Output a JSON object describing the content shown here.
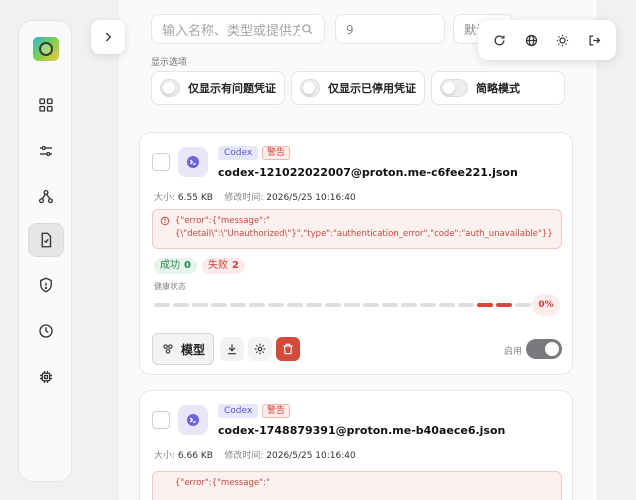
{
  "sidebar": {
    "items": [
      {
        "icon": "grid-icon"
      },
      {
        "icon": "sliders-icon"
      },
      {
        "icon": "share-nodes-icon"
      },
      {
        "icon": "document-check-icon",
        "active": true
      },
      {
        "icon": "shield-icon"
      },
      {
        "icon": "clock-icon"
      },
      {
        "icon": "chip-icon"
      }
    ]
  },
  "filters": {
    "search_placeholder": "输入名称、类型或提供方",
    "page_size": "9",
    "sort_label": "默认"
  },
  "display_options": {
    "label": "显示选项",
    "toggles": [
      {
        "label": "仅显示有问题凭证",
        "on": false
      },
      {
        "label": "仅显示已停用凭证",
        "on": false
      },
      {
        "label": "简略模式",
        "on": false
      }
    ]
  },
  "cards": [
    {
      "provider": "Codex",
      "status": "警告",
      "name": "codex-121022022007@proton.me-c6fee221.json",
      "size_label": "大小:",
      "size": "6.55 KB",
      "modified_label": "修改时间:",
      "modified": "2026/5/25 10:16:40",
      "error_line1": "{\"error\":{\"message\":\"",
      "error_line2": "{\\\"detail\\\":\\\"Unauthorized\\\"}\",\"type\":\"authentication_error\",\"code\":\"auth_unavailable\"}}",
      "success_label": "成功",
      "success": "0",
      "fail_label": "失败",
      "fail": "2",
      "health_label": "健康状态",
      "health_pct": "0%",
      "health_segments": 20,
      "health_bad": [
        17,
        18
      ],
      "model_button": "模型",
      "enable_label": "启用",
      "enabled": true
    },
    {
      "provider": "Codex",
      "status": "警告",
      "name": "codex-1748879391@proton.me-b40aece6.json",
      "size_label": "大小:",
      "size": "6.66 KB",
      "modified_label": "修改时间:",
      "modified": "2026/5/25 10:16:40",
      "error_line1": "{\"error\":{\"message\":\""
    }
  ],
  "colors": {
    "accent": "#5a56c8",
    "danger": "#d44a3a",
    "success": "#2a8a4f"
  }
}
